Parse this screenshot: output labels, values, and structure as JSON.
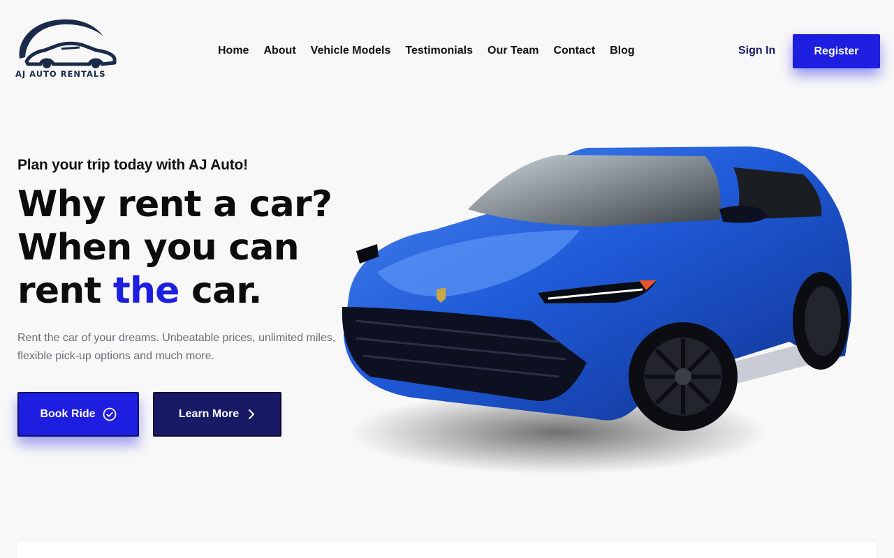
{
  "brand": {
    "name": "AJ AUTO RENTALS",
    "logo_icon": "car-logo-icon"
  },
  "nav": {
    "items": [
      {
        "label": "Home"
      },
      {
        "label": "About"
      },
      {
        "label": "Vehicle Models"
      },
      {
        "label": "Testimonials"
      },
      {
        "label": "Our Team"
      },
      {
        "label": "Contact"
      },
      {
        "label": "Blog"
      }
    ],
    "sign_in": "Sign In",
    "register": "Register"
  },
  "hero": {
    "kicker": "Plan your trip today with AJ Auto!",
    "title_line1": "Why rent a car?",
    "title_line2": "When you can",
    "title_line3_pre": "rent ",
    "title_line3_accent": "the",
    "title_line3_post": " car.",
    "description": "Rent the car of your dreams. Unbeatable prices, unlimited miles, flexible pick-up options and much more.",
    "book_button": "Book Ride",
    "book_icon": "check-circle-icon",
    "learn_button": "Learn More",
    "learn_icon": "chevron-right-icon",
    "car_image": "blue-suv-image"
  },
  "colors": {
    "accent": "#1e1ee0",
    "navy": "#181a66",
    "background": "#f8f8f8",
    "muted_text": "#6b6b73"
  }
}
